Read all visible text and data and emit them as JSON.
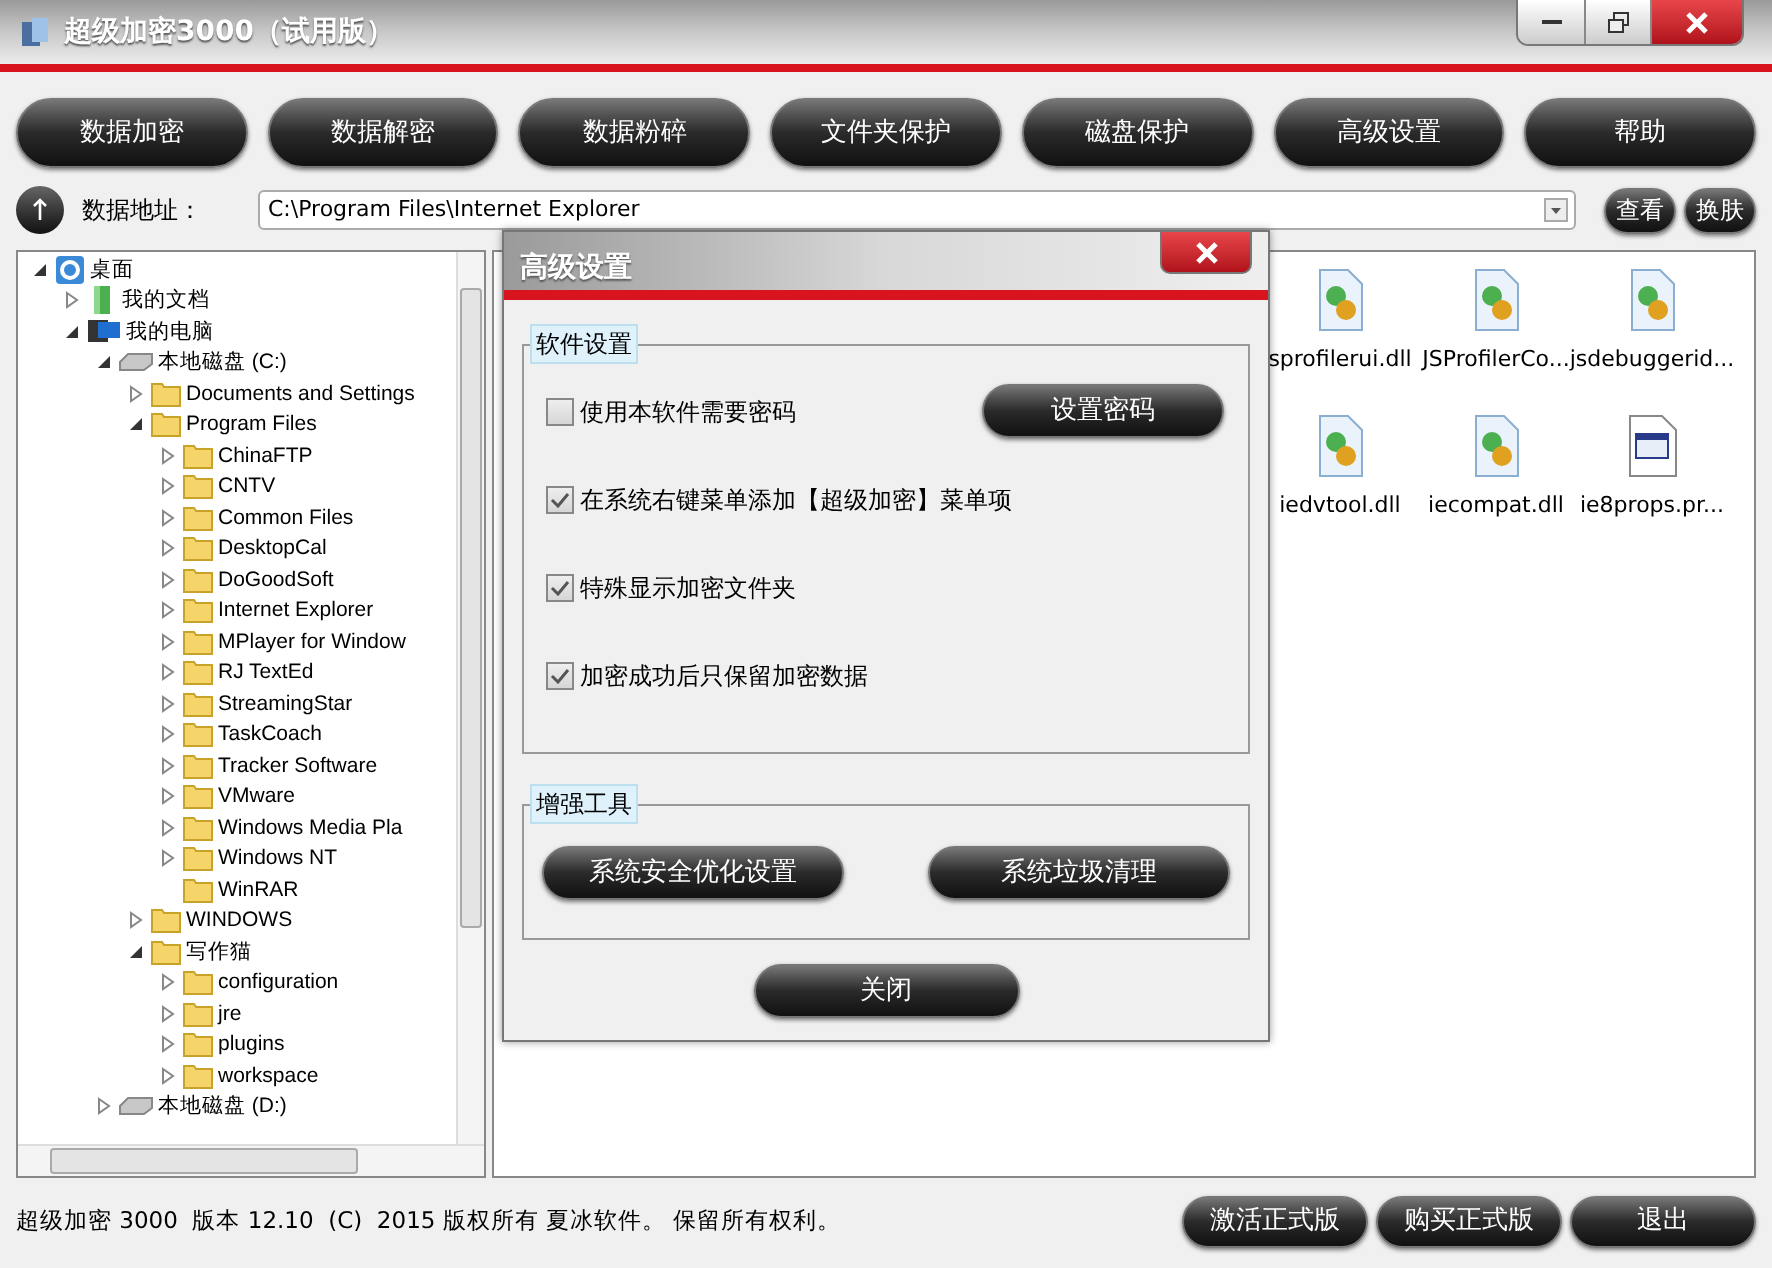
{
  "window": {
    "title": "超级加密3000（试用版）"
  },
  "toolbar": [
    "数据加密",
    "数据解密",
    "数据粉碎",
    "文件夹保护",
    "磁盘保护",
    "高级设置",
    "帮助"
  ],
  "address": {
    "label": "数据地址：",
    "value": "C:\\Program Files\\Internet Explorer"
  },
  "address_buttons": [
    "查看",
    "换肤"
  ],
  "tree": [
    {
      "label": "桌面",
      "kind": "desktop",
      "expanded": true,
      "children": [
        {
          "label": "我的文档",
          "kind": "documents",
          "expanded": false
        },
        {
          "label": "我的电脑",
          "kind": "computer",
          "expanded": true,
          "children": [
            {
              "label": "本地磁盘 (C:)",
              "kind": "drive",
              "expanded": true,
              "children": [
                {
                  "label": "Documents and Settings",
                  "kind": "folder",
                  "expanded": false
                },
                {
                  "label": "Program Files",
                  "kind": "folder",
                  "expanded": true,
                  "children": [
                    {
                      "label": "ChinaFTP",
                      "kind": "folder",
                      "expanded": false
                    },
                    {
                      "label": "CNTV",
                      "kind": "folder",
                      "expanded": false
                    },
                    {
                      "label": "Common Files",
                      "kind": "folder",
                      "expanded": false
                    },
                    {
                      "label": "DesktopCal",
                      "kind": "folder",
                      "expanded": false
                    },
                    {
                      "label": "DoGoodSoft",
                      "kind": "folder",
                      "expanded": false
                    },
                    {
                      "label": "Internet Explorer",
                      "kind": "folder",
                      "expanded": false
                    },
                    {
                      "label": "MPlayer for Window",
                      "kind": "folder",
                      "expanded": false
                    },
                    {
                      "label": "RJ TextEd",
                      "kind": "folder",
                      "expanded": false
                    },
                    {
                      "label": "StreamingStar",
                      "kind": "folder",
                      "expanded": false
                    },
                    {
                      "label": "TaskCoach",
                      "kind": "folder",
                      "expanded": false
                    },
                    {
                      "label": "Tracker Software",
                      "kind": "folder",
                      "expanded": false
                    },
                    {
                      "label": "VMware",
                      "kind": "folder",
                      "expanded": false
                    },
                    {
                      "label": "Windows Media Pla",
                      "kind": "folder",
                      "expanded": false
                    },
                    {
                      "label": "Windows NT",
                      "kind": "folder",
                      "expanded": false
                    },
                    {
                      "label": "WinRAR",
                      "kind": "folder"
                    }
                  ]
                },
                {
                  "label": "WINDOWS",
                  "kind": "folder",
                  "expanded": false
                },
                {
                  "label": "写作猫",
                  "kind": "folder",
                  "expanded": true,
                  "children": [
                    {
                      "label": "configuration",
                      "kind": "folder",
                      "expanded": false
                    },
                    {
                      "label": "jre",
                      "kind": "folder",
                      "expanded": false
                    },
                    {
                      "label": "plugins",
                      "kind": "folder",
                      "expanded": false
                    },
                    {
                      "label": "workspace",
                      "kind": "folder",
                      "expanded": false
                    }
                  ]
                }
              ]
            },
            {
              "label": "本地磁盘 (D:)",
              "kind": "drive",
              "expanded": false
            }
          ]
        }
      ]
    }
  ],
  "files": [
    {
      "name": "sprofilerui.dll",
      "kind": "dll"
    },
    {
      "name": "JSProfilerCo...",
      "kind": "dll"
    },
    {
      "name": "jsdebuggerid...",
      "kind": "dll"
    },
    {
      "name": "iedvtool.dll",
      "kind": "dll"
    },
    {
      "name": "iecompat.dll",
      "kind": "dll"
    },
    {
      "name": "ie8props.pr...",
      "kind": "app"
    }
  ],
  "dialog": {
    "title": "高级设置",
    "groups": [
      {
        "title": "软件设置",
        "items": [
          {
            "kind": "checkbox",
            "label": "使用本软件需要密码",
            "checked": false,
            "button": "设置密码"
          },
          {
            "kind": "checkbox",
            "label": "在系统右键菜单添加【超级加密】菜单项",
            "checked": true
          },
          {
            "kind": "checkbox",
            "label": "特殊显示加密文件夹",
            "checked": true
          },
          {
            "kind": "checkbox",
            "label": "加密成功后只保留加密数据",
            "checked": true
          }
        ]
      },
      {
        "title": "增强工具",
        "items": [
          {
            "kind": "button",
            "label": "系统安全优化设置"
          },
          {
            "kind": "button",
            "label": "系统垃圾清理"
          }
        ]
      }
    ],
    "close": "关闭"
  },
  "status": {
    "text": "超级加密 3000  版本 12.10  (C)  2015 版权所有 夏冰软件。 保留所有权利。",
    "buttons": [
      "激活正式版",
      "购买正式版",
      "退出"
    ]
  }
}
